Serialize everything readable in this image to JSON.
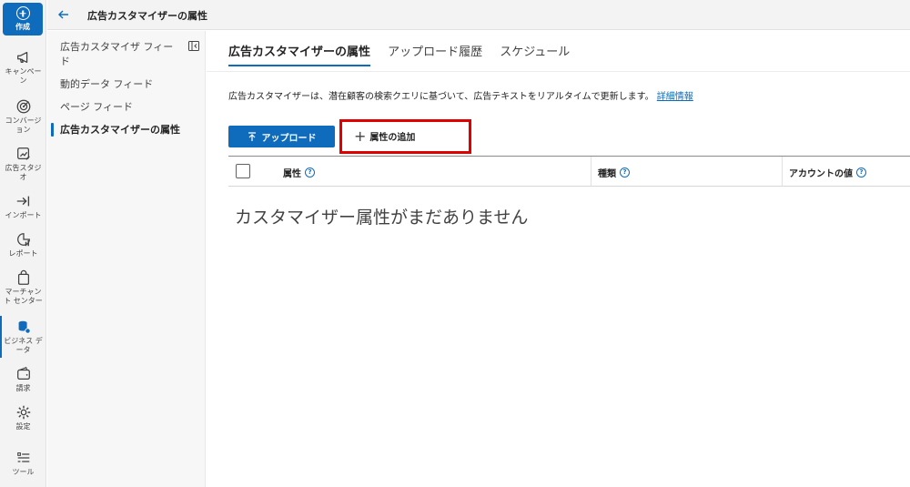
{
  "rail": {
    "create_label": "作成",
    "items": [
      {
        "label": "キャンペーン",
        "icon": "megaphone-icon"
      },
      {
        "label": "コンバージョン",
        "icon": "target-icon"
      },
      {
        "label": "広告スタジオ",
        "icon": "ad-studio-icon"
      },
      {
        "label": "インポート",
        "icon": "import-icon"
      },
      {
        "label": "レポート",
        "icon": "report-icon"
      },
      {
        "label": "マーチャント センター",
        "icon": "shopping-bag-icon"
      },
      {
        "label": "ビジネス データ",
        "icon": "database-icon"
      },
      {
        "label": "請求",
        "icon": "wallet-icon"
      },
      {
        "label": "設定",
        "icon": "gear-icon"
      },
      {
        "label": "ツール",
        "icon": "tools-icon"
      }
    ]
  },
  "header": {
    "title": "広告カスタマイザーの属性"
  },
  "subnav": {
    "items": [
      {
        "label": "広告カスタマイザ フィード"
      },
      {
        "label": "動的データ フィード"
      },
      {
        "label": "ページ フィード"
      },
      {
        "label": "広告カスタマイザーの属性"
      }
    ]
  },
  "tabs": [
    {
      "label": "広告カスタマイザーの属性"
    },
    {
      "label": "アップロード履歴"
    },
    {
      "label": "スケジュール"
    }
  ],
  "description": {
    "text": "広告カスタマイザーは、潜在顧客の検索クエリに基づいて、広告テキストをリアルタイムで更新します。",
    "link": "詳細情報"
  },
  "toolbar": {
    "upload_label": "アップロード",
    "add_label": "属性の追加"
  },
  "table": {
    "columns": [
      "属性",
      "種類",
      "アカウントの値"
    ],
    "empty_message": "カスタマイザー属性がまだありません"
  },
  "colors": {
    "accent": "#0f6cbd",
    "highlight": "#e00000"
  }
}
